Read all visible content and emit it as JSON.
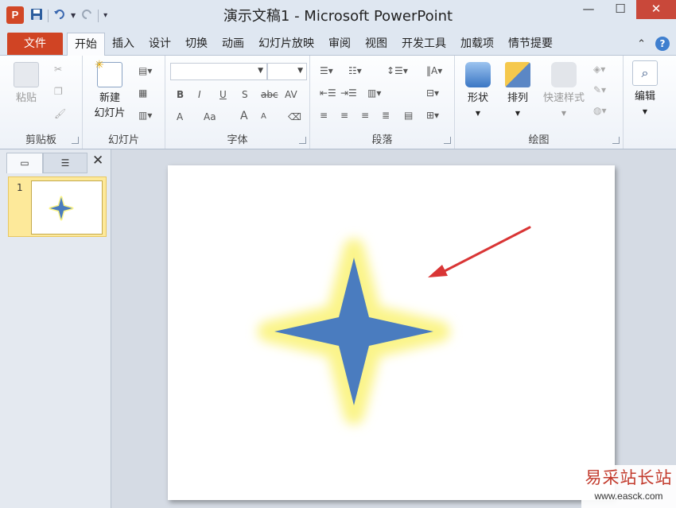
{
  "window": {
    "title": "演示文稿1 - Microsoft PowerPoint",
    "app_icon": "P"
  },
  "quick_access": {
    "save_icon": "save-icon",
    "undo_icon": "undo-icon",
    "redo_icon": "redo-icon",
    "customize_icon": "customize-icon"
  },
  "tabs": {
    "file": "文件",
    "items": [
      "开始",
      "插入",
      "设计",
      "切换",
      "动画",
      "幻灯片放映",
      "审阅",
      "视图",
      "开发工具",
      "加载项",
      "情节提要"
    ]
  },
  "ribbon": {
    "clipboard": {
      "paste": "粘贴",
      "label": "剪贴板"
    },
    "slides": {
      "new_slide_line1": "新建",
      "new_slide_line2": "幻灯片",
      "label": "幻灯片"
    },
    "font": {
      "label": "字体",
      "bold": "B",
      "italic": "I",
      "underline": "U",
      "shadow": "S",
      "strike": "abc",
      "spacing": "AV",
      "font_color": "A",
      "case": "Aa",
      "grow": "A",
      "shrink": "A"
    },
    "paragraph": {
      "label": "段落"
    },
    "drawing": {
      "shapes": "形状",
      "arrange": "排列",
      "quick_styles": "快速样式",
      "label": "绘图"
    },
    "editing": {
      "label": "编辑"
    }
  },
  "slides_pane": {
    "slide_numbers": [
      "1"
    ]
  },
  "colors": {
    "file_tab": "#d04424",
    "star_fill": "#4a7cbf",
    "star_glow": "#fbf48a",
    "arrow": "#d93535"
  },
  "watermark": {
    "title": "易采站长站",
    "url": "www.easck.com"
  }
}
